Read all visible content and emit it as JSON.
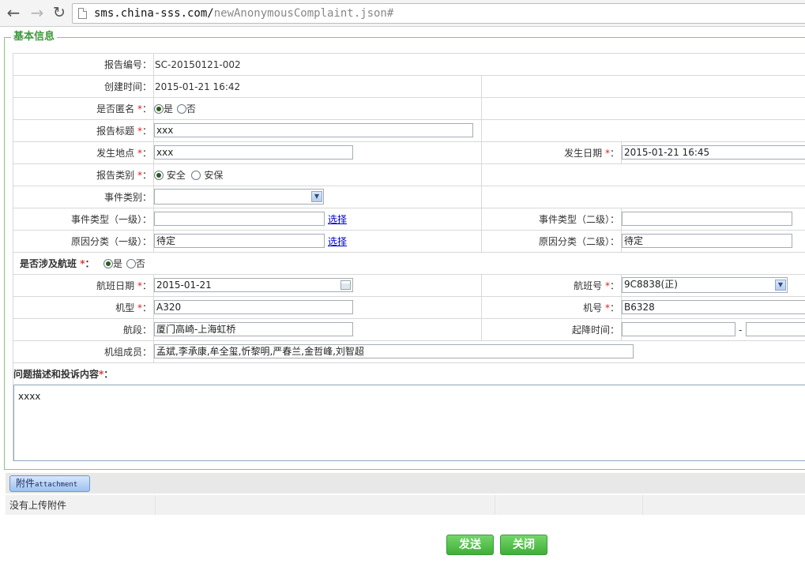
{
  "browser": {
    "url_host": "sms.china-sss.com/",
    "url_path": "newAnonymousComplaint.json#"
  },
  "form": {
    "legend": "基本信息",
    "report_no": {
      "label": "报告编号：",
      "value": "SC-20150121-002"
    },
    "created": {
      "label": "创建时间：",
      "value": "2015-01-21 16:42"
    },
    "anonymous": {
      "label": "是否匿名",
      "colon": "：",
      "opt_yes": "是",
      "opt_no": "否",
      "selected": "是"
    },
    "title": {
      "label": "报告标题",
      "colon": "：",
      "value": "xxx"
    },
    "location": {
      "label": "发生地点",
      "colon": "：",
      "value": "xxx"
    },
    "occur_date": {
      "label": "发生日期",
      "colon": "：",
      "value": "2015-01-21 16:45"
    },
    "category": {
      "label": "报告类别",
      "colon": "：",
      "opt_a": "安全",
      "opt_b": "安保",
      "selected": "安全"
    },
    "event_category": {
      "label": "事件类别：",
      "value": ""
    },
    "event_type1": {
      "label": "事件类型（一级）：",
      "value": "",
      "link": "选择"
    },
    "event_type2": {
      "label": "事件类型（二级）：",
      "value": ""
    },
    "cause1": {
      "label": "原因分类（一级）：",
      "value": "待定",
      "link": "选择"
    },
    "cause2": {
      "label": "原因分类（二级）：",
      "value": "待定"
    },
    "flight_involved": {
      "label": "是否涉及航班",
      "colon": "：",
      "opt_yes": "是",
      "opt_no": "否",
      "selected": "是"
    },
    "flight_date": {
      "label": "航班日期",
      "colon": "：",
      "value": "2015-01-21"
    },
    "flight_no": {
      "label": "航班号",
      "colon": "：",
      "value": "9C8838(正)"
    },
    "aircraft_type": {
      "label": "机型",
      "colon": "：",
      "value": "A320"
    },
    "aircraft_no": {
      "label": "机号",
      "colon": "：",
      "value": "B6328"
    },
    "segment": {
      "label": "航段：",
      "value": "厦门高崎-上海虹桥"
    },
    "takeoff_landing": {
      "label": "起降时间：",
      "from": "",
      "sep": "-",
      "to": ""
    },
    "crew": {
      "label": "机组成员：",
      "value": "孟斌,李承康,牟全玺,忻黎明,严春兰,金哲峰,刘智超"
    },
    "description": {
      "label": "问题描述和投诉内容",
      "colon": "：",
      "value": "xxxx"
    },
    "required_mark": "*"
  },
  "attachment": {
    "button_cn": "附件",
    "button_en": "attachment",
    "empty_text": "没有上传附件"
  },
  "actions": {
    "send": "发送",
    "close": "关闭"
  },
  "colors": {
    "legend_green": "#3c9a3c",
    "button_green": "#3eae37",
    "required_red": "#e02020",
    "link_blue": "#0000cc"
  },
  "icons": [
    "back-arrow-icon",
    "forward-arrow-icon",
    "reload-icon",
    "page-icon",
    "chevron-down-icon",
    "calendar-icon"
  ]
}
